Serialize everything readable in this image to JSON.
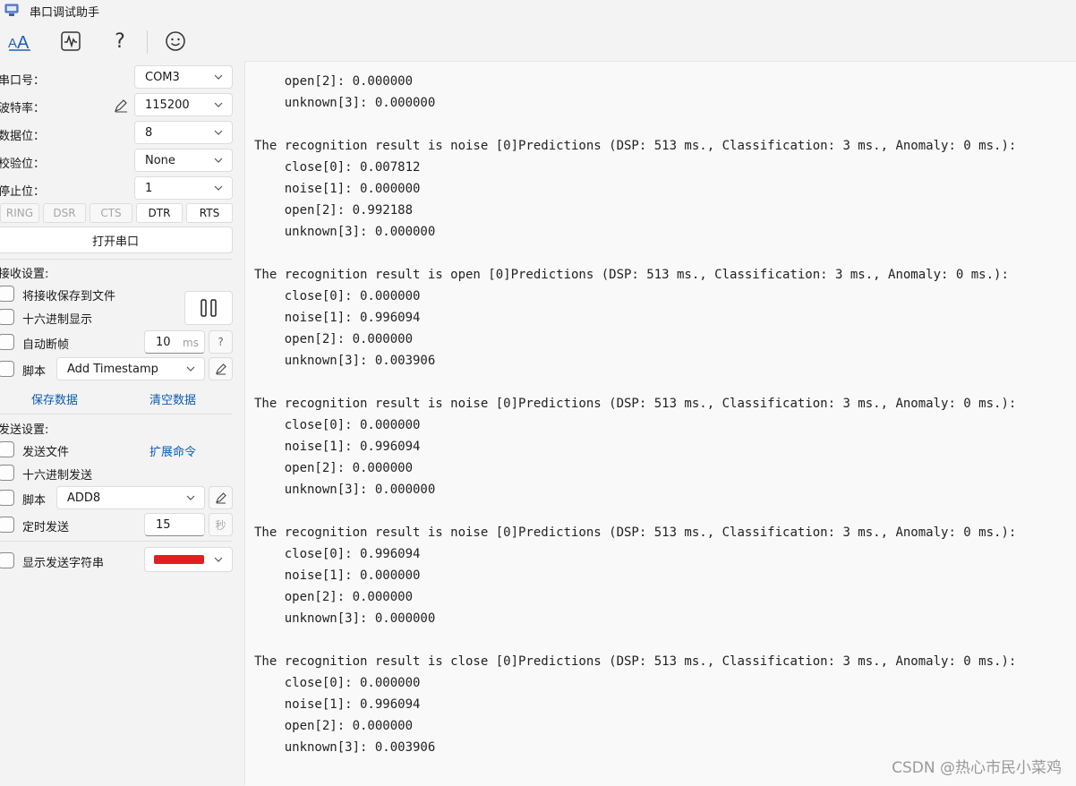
{
  "app": {
    "title": "串口调试助手"
  },
  "toolbar": {
    "text_mode_icon": "text-mode-icon",
    "waveform_icon": "waveform-icon",
    "help_icon": "help-icon",
    "emoji_icon": "emoji-icon"
  },
  "serial": {
    "port_label": "串口号：",
    "port_value": "COM3",
    "baud_label": "波特率：",
    "baud_value": "115200",
    "databits_label": "数据位：",
    "databits_value": "8",
    "parity_label": "校验位：",
    "parity_value": "None",
    "stopbits_label": "停止位：",
    "stopbits_value": "1",
    "signals": [
      {
        "label": "RING",
        "active": false
      },
      {
        "label": "DSR",
        "active": false
      },
      {
        "label": "CTS",
        "active": false
      },
      {
        "label": "DTR",
        "active": true
      },
      {
        "label": "RTS",
        "active": true
      }
    ],
    "open_button": "打开串口"
  },
  "receive": {
    "section_label": "接收设置:",
    "save_to_file": "将接收保存到文件",
    "hex_display": "十六进制显示",
    "auto_frame": "自动断帧",
    "auto_frame_value": "10",
    "auto_frame_unit": "ms",
    "help_label": "?",
    "script_label": "脚本",
    "script_value": "Add Timestamp",
    "save_data": "保存数据",
    "clear_data": "清空数据"
  },
  "send": {
    "section_label": "发送设置:",
    "send_file": "发送文件",
    "extend_cmd": "扩展命令",
    "hex_send": "十六进制发送",
    "script_label": "脚本",
    "script_value": "ADD8",
    "timed_send": "定时发送",
    "timed_value": "15",
    "timed_unit": "秒",
    "show_send": "显示发送字符串",
    "color_swatch": "#e02020"
  },
  "output": {
    "lines": [
      "    open[2]: 0.000000",
      "    unknown[3]: 0.000000",
      "",
      "The recognition result is noise [0]Predictions (DSP: 513 ms., Classification: 3 ms., Anomaly: 0 ms.):",
      "    close[0]: 0.007812",
      "    noise[1]: 0.000000",
      "    open[2]: 0.992188",
      "    unknown[3]: 0.000000",
      "",
      "The recognition result is open [0]Predictions (DSP: 513 ms., Classification: 3 ms., Anomaly: 0 ms.):",
      "    close[0]: 0.000000",
      "    noise[1]: 0.996094",
      "    open[2]: 0.000000",
      "    unknown[3]: 0.003906",
      "",
      "The recognition result is noise [0]Predictions (DSP: 513 ms., Classification: 3 ms., Anomaly: 0 ms.):",
      "    close[0]: 0.000000",
      "    noise[1]: 0.996094",
      "    open[2]: 0.000000",
      "    unknown[3]: 0.000000",
      "",
      "The recognition result is noise [0]Predictions (DSP: 513 ms., Classification: 3 ms., Anomaly: 0 ms.):",
      "    close[0]: 0.996094",
      "    noise[1]: 0.000000",
      "    open[2]: 0.000000",
      "    unknown[3]: 0.000000",
      "",
      "The recognition result is close [0]Predictions (DSP: 513 ms., Classification: 3 ms., Anomaly: 0 ms.):",
      "    close[0]: 0.000000",
      "    noise[1]: 0.996094",
      "    open[2]: 0.000000",
      "    unknown[3]: 0.003906"
    ]
  },
  "watermark": "CSDN @热心市民小菜鸡"
}
